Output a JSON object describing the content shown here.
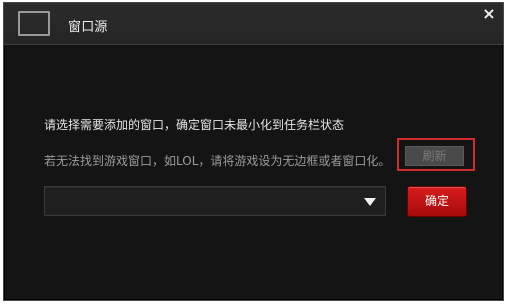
{
  "dialog": {
    "title": "窗口源",
    "icons": {
      "window": "window-icon",
      "close": "close-icon"
    },
    "close_glyph": "×",
    "instructions": {
      "line1": "请选择需要添加的窗口，确定窗口未最小化到任务栏状态",
      "line2": "若无法找到游戏窗口，如LOL，请将游戏设为无边框或者窗口化。"
    },
    "buttons": {
      "refresh": "刷新",
      "confirm": "确定"
    },
    "window_select": {
      "selected": ""
    },
    "colors": {
      "background": "#141414",
      "titlebar": "#252525",
      "accent_red": "#d61d1d",
      "highlight_red": "#d12b2b"
    }
  }
}
